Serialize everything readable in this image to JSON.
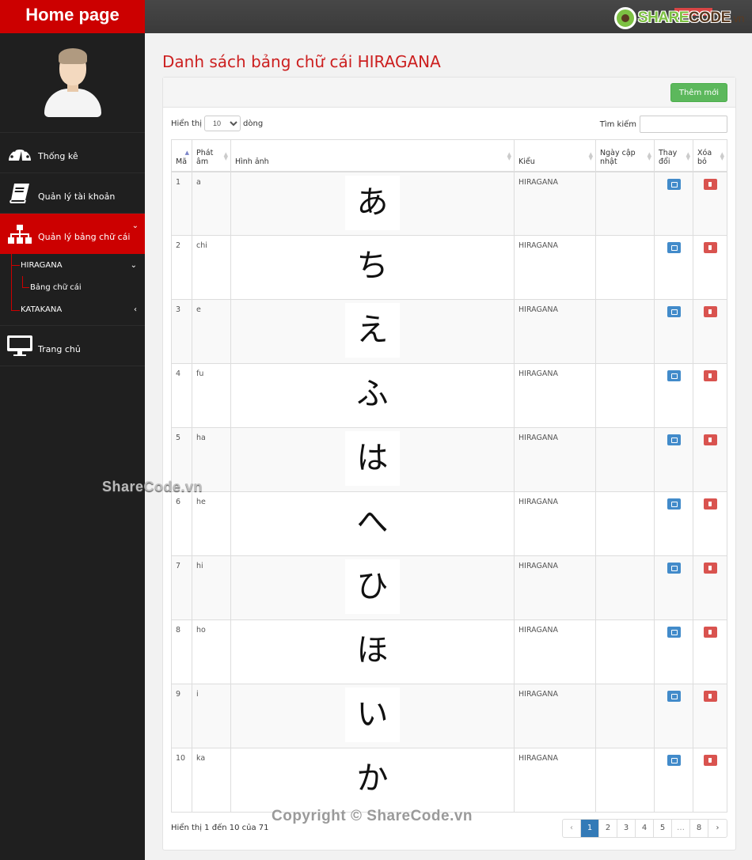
{
  "header": {
    "brand": "Home page",
    "logo": {
      "share": "SHARE",
      "code": "CODE",
      "vn": ".vn"
    }
  },
  "sidebar": {
    "items": [
      {
        "label": "Thống kê",
        "icon": "dashboard-icon"
      },
      {
        "label": "Quản lý tài khoản",
        "icon": "book-icon"
      },
      {
        "label": "Quản lý bảng chữ cái",
        "icon": "sitemap-icon",
        "active": true
      },
      {
        "label": "Trang chủ",
        "icon": "desktop-icon"
      }
    ],
    "submenu": [
      {
        "label": "HIRAGANA",
        "caret": "⌄"
      },
      {
        "label": "Bảng chữ cái"
      },
      {
        "label": "KATAKANA",
        "caret": "‹"
      }
    ],
    "caret_open": "⌄"
  },
  "main": {
    "title": "Danh sách bảng chữ cái HIRAGANA",
    "add_button": "Thêm mới",
    "length": {
      "prefix": "Hiển thị",
      "value": "10",
      "suffix": "dòng"
    },
    "search": {
      "label": "Tìm kiếm",
      "value": ""
    },
    "columns": [
      "Mã",
      "Phát âm",
      "Hình ảnh",
      "Kiểu",
      "Ngày cập nhật",
      "Thay đổi",
      "Xóa bỏ"
    ],
    "rows": [
      {
        "id": "1",
        "pron": "a",
        "kana": "あ",
        "type": "HIRAGANA",
        "date": ""
      },
      {
        "id": "2",
        "pron": "chi",
        "kana": "ち",
        "type": "HIRAGANA",
        "date": ""
      },
      {
        "id": "3",
        "pron": "e",
        "kana": "え",
        "type": "HIRAGANA",
        "date": ""
      },
      {
        "id": "4",
        "pron": "fu",
        "kana": "ふ",
        "type": "HIRAGANA",
        "date": ""
      },
      {
        "id": "5",
        "pron": "ha",
        "kana": "は",
        "type": "HIRAGANA",
        "date": ""
      },
      {
        "id": "6",
        "pron": "he",
        "kana": "へ",
        "type": "HIRAGANA",
        "date": ""
      },
      {
        "id": "7",
        "pron": "hi",
        "kana": "ひ",
        "type": "HIRAGANA",
        "date": ""
      },
      {
        "id": "8",
        "pron": "ho",
        "kana": "ほ",
        "type": "HIRAGANA",
        "date": ""
      },
      {
        "id": "9",
        "pron": "i",
        "kana": "い",
        "type": "HIRAGANA",
        "date": ""
      },
      {
        "id": "10",
        "pron": "ka",
        "kana": "か",
        "type": "HIRAGANA",
        "date": ""
      }
    ],
    "info": "Hiển thị 1 đến 10 của 71",
    "pagination": [
      "‹",
      "1",
      "2",
      "3",
      "4",
      "5",
      "…",
      "8",
      "›"
    ],
    "current_page": "1"
  },
  "watermarks": [
    "ShareCode.vn",
    "Copyright © ShareCode.vn"
  ]
}
